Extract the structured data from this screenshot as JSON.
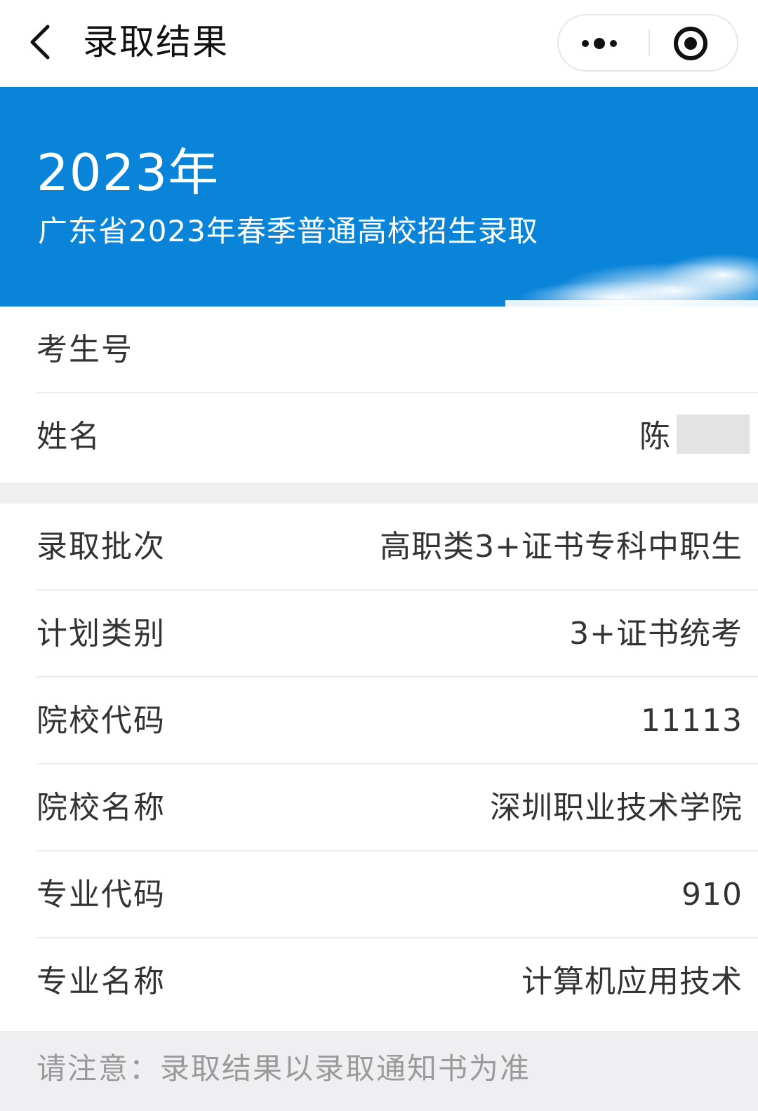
{
  "navbar": {
    "title": "录取结果",
    "back_icon": "chevron-left-icon",
    "more_icon": "more-dots-icon",
    "close_icon": "target-close-icon"
  },
  "banner": {
    "year": "2023年",
    "subtitle": "广东省2023年春季普通高校招生录取",
    "color": "#0a84d9"
  },
  "basic_info": [
    {
      "label": "考生号",
      "value": ""
    },
    {
      "label": "姓名",
      "value": "陈"
    }
  ],
  "admission_info": [
    {
      "label": "录取批次",
      "value": "高职类3+证书专科中职生"
    },
    {
      "label": "计划类别",
      "value": "3+证书统考"
    },
    {
      "label": "院校代码",
      "value": "11113"
    },
    {
      "label": "院校名称",
      "value": "深圳职业技术学院"
    },
    {
      "label": "专业代码",
      "value": "910"
    },
    {
      "label": "专业名称",
      "value": "计算机应用技术"
    }
  ],
  "footer": {
    "note": "请注意：录取结果以录取通知书为准"
  }
}
